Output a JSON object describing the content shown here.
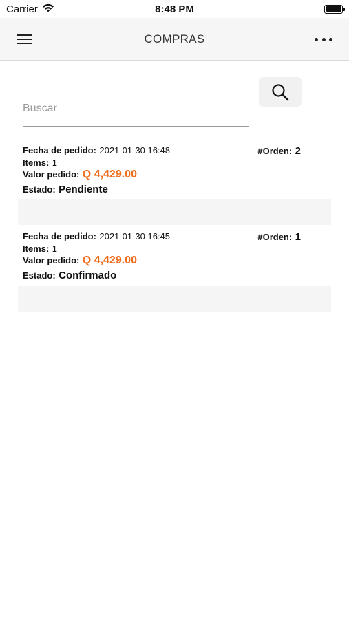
{
  "status_bar": {
    "carrier": "Carrier",
    "time": "8:48 PM"
  },
  "nav": {
    "title": "COMPRAS",
    "menu_icon": "hamburger-icon",
    "more_icon": "more-horizontal-icon"
  },
  "search": {
    "placeholder": "Buscar",
    "value": "",
    "button_icon": "search-icon"
  },
  "labels": {
    "date": "Fecha de pedido:",
    "items": "Items:",
    "value": "Valor pedido:",
    "status": "Estado:",
    "order": "#Orden:"
  },
  "orders": [
    {
      "date": "2021-01-30 16:48",
      "items": "1",
      "value": "Q 4,429.00",
      "status": "Pendiente",
      "order_number": "2"
    },
    {
      "date": "2021-01-30 16:45",
      "items": "1",
      "value": "Q 4,429.00",
      "status": "Confirmado",
      "order_number": "1"
    }
  ],
  "colors": {
    "accent_price": "#ee6c1a",
    "nav_background": "#f6f6f6",
    "card_footer": "#f5f5f5"
  }
}
